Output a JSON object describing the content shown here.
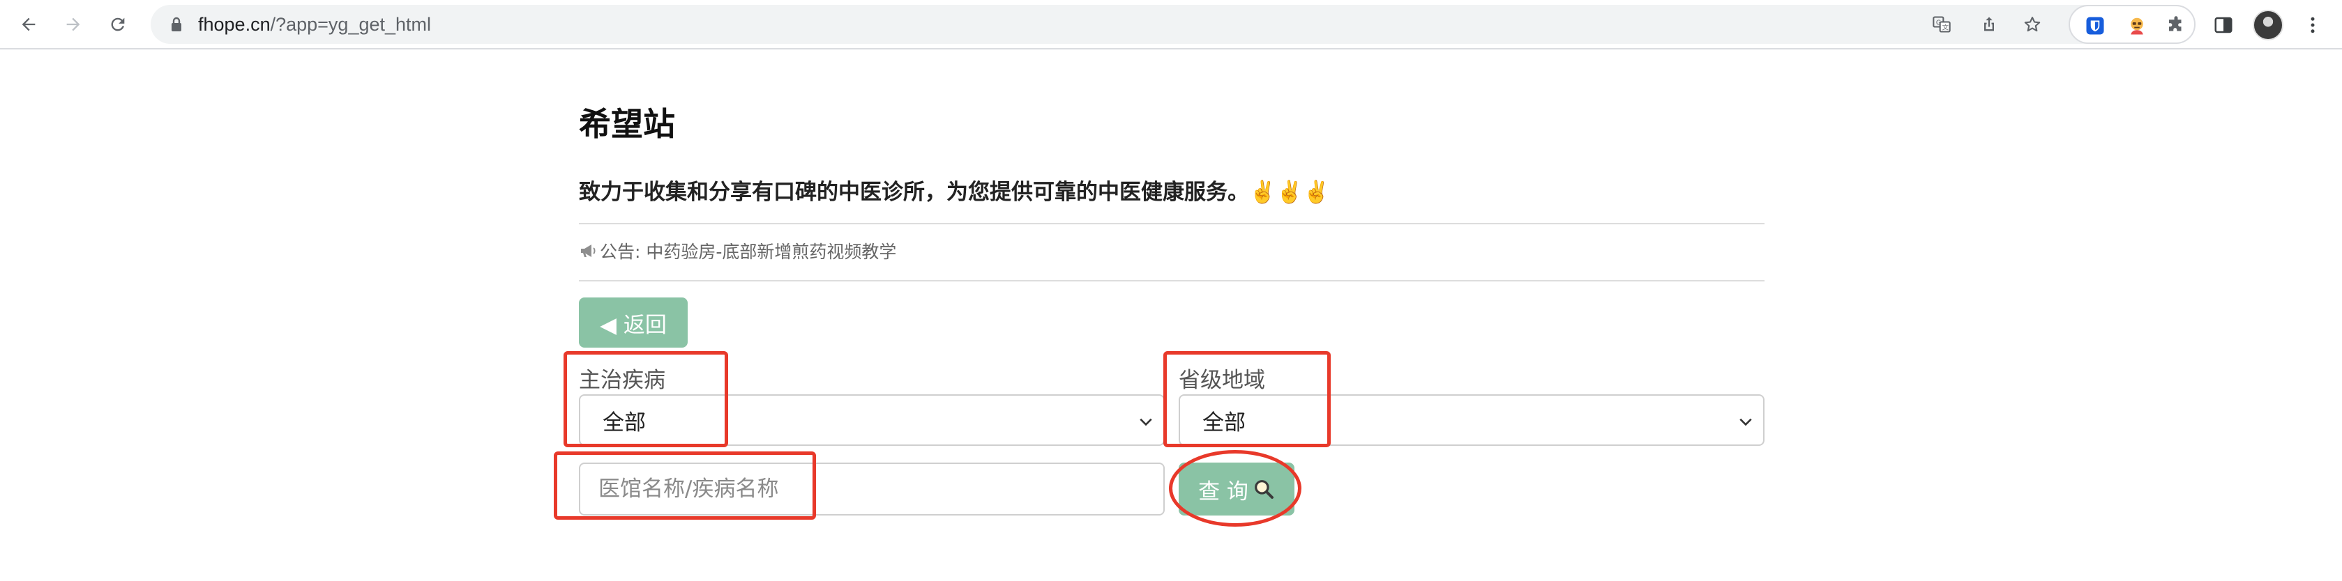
{
  "browser": {
    "url_host": "fhope.cn",
    "url_path": "/?app=yg_get_html",
    "icons": [
      "back-arrow-icon",
      "forward-arrow-icon",
      "reload-icon",
      "lock-icon",
      "translate-icon",
      "share-icon",
      "star-icon",
      "bitwarden-icon",
      "avatar-extension-icon",
      "puzzle-icon",
      "side-panel-icon",
      "profile-avatar",
      "more-menu-icon"
    ]
  },
  "site": {
    "title": "希望站",
    "tagline": "致力于收集和分享有口碑的中医诊所，为您提供可靠的中医健康服务。✌️✌️✌️",
    "announcement": "公告: 中药验房-底部新增煎药视频教学"
  },
  "form": {
    "back_label": "◀ 返回",
    "disease_label": "主治疾病",
    "disease_selected": "全部",
    "region_label": "省级地域",
    "region_selected": "全部",
    "search_placeholder": "医馆名称/疾病名称",
    "query_label": "查 询"
  },
  "colors": {
    "accent": "#8ac3a5",
    "annotation": "#e8392a"
  }
}
